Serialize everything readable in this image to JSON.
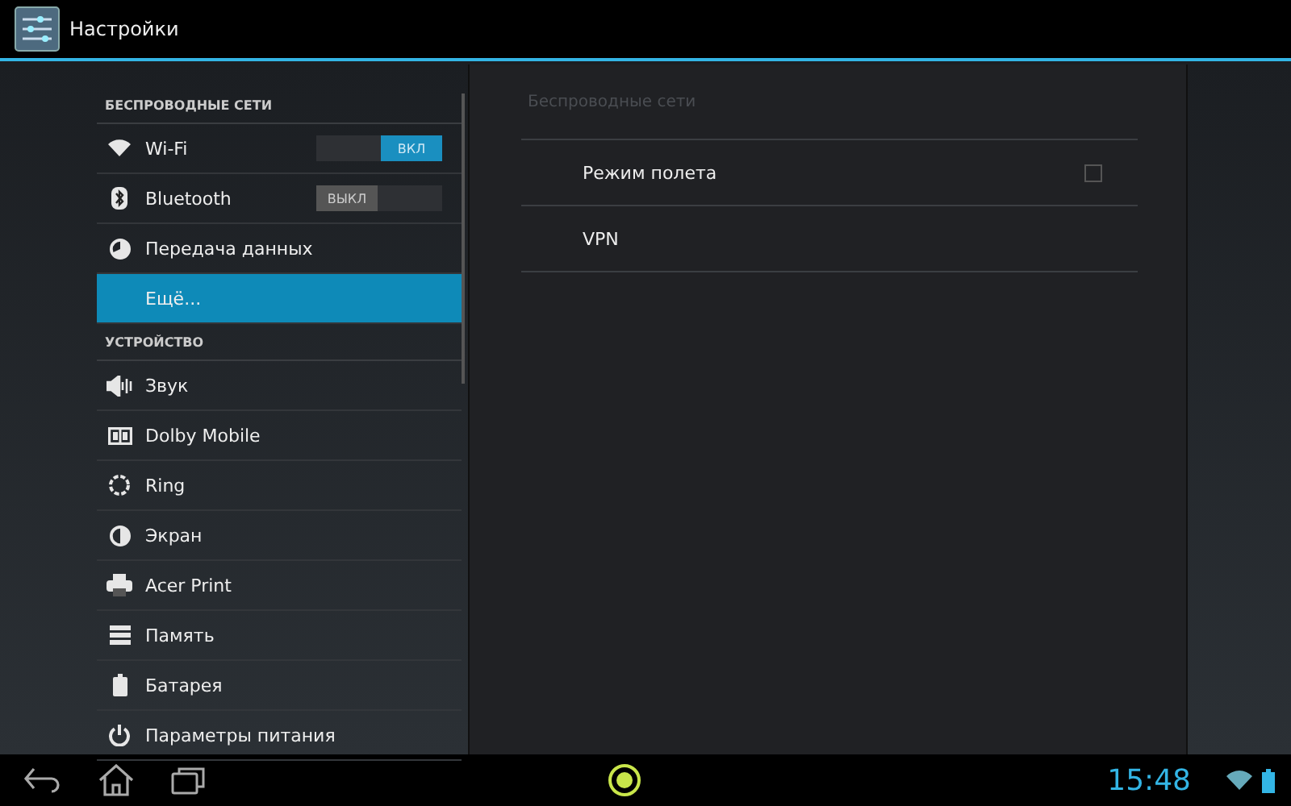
{
  "window": {
    "title": "Настройки"
  },
  "sidebar": {
    "sections": [
      {
        "header": "БЕСПРОВОДНЫЕ СЕТИ",
        "items": [
          {
            "label": "Wi-Fi",
            "kind": "toggle",
            "on": true,
            "toggle_label": "ВКЛ",
            "selected": false
          },
          {
            "label": "Bluetooth",
            "kind": "toggle",
            "on": false,
            "toggle_label": "ВЫКЛ",
            "selected": false
          },
          {
            "label": "Передача данных",
            "kind": "plain",
            "selected": false
          },
          {
            "label": "Ещё...",
            "kind": "plain",
            "selected": true
          }
        ]
      },
      {
        "header": "УСТРОЙСТВО",
        "items": [
          {
            "label": "Звук",
            "kind": "plain",
            "selected": false
          },
          {
            "label": "Dolby Mobile",
            "kind": "plain",
            "selected": false
          },
          {
            "label": "Ring",
            "kind": "plain",
            "selected": false
          },
          {
            "label": "Экран",
            "kind": "plain",
            "selected": false
          },
          {
            "label": "Acer Print",
            "kind": "plain",
            "selected": false
          },
          {
            "label": "Память",
            "kind": "plain",
            "selected": false
          },
          {
            "label": "Батарея",
            "kind": "plain",
            "selected": false
          },
          {
            "label": "Параметры питания",
            "kind": "plain",
            "selected": false
          }
        ]
      }
    ]
  },
  "detail": {
    "header": "Беспроводные сети",
    "items": [
      {
        "label": "Режим полета",
        "kind": "checkbox",
        "checked": false
      },
      {
        "label": "VPN",
        "kind": "plain"
      }
    ]
  },
  "status_bar": {
    "time": "15:48"
  }
}
